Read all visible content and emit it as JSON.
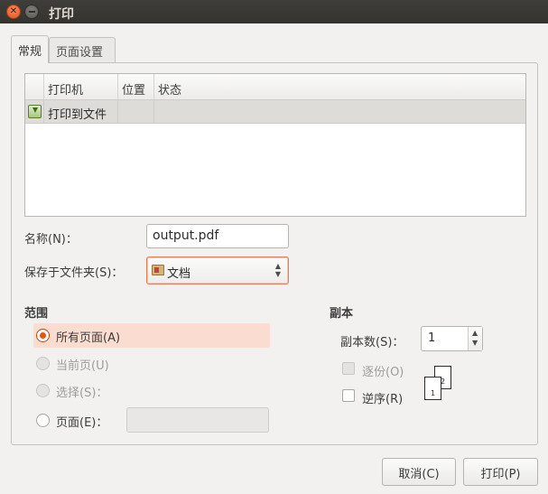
{
  "window": {
    "title": "打印"
  },
  "tabs": [
    {
      "label": "常规",
      "active": true
    },
    {
      "label": "页面设置",
      "active": false
    }
  ],
  "printer_list": {
    "columns": [
      "打印机",
      "位置",
      "状态"
    ],
    "rows": [
      {
        "icon": "print-to-file-icon",
        "name": "打印到文件",
        "location": "",
        "status": "",
        "selected": true
      }
    ]
  },
  "name_field": {
    "label": "名称(N)：",
    "value": "output.pdf"
  },
  "folder_field": {
    "label": "保存于文件夹(S)：",
    "value": "文档",
    "icon": "folder-icon"
  },
  "range": {
    "title": "范围",
    "options": [
      {
        "label": "所有页面(A)",
        "checked": true,
        "enabled": true
      },
      {
        "label": "当前页(U)",
        "checked": false,
        "enabled": false
      },
      {
        "label": "选择(S)：",
        "checked": false,
        "enabled": false
      },
      {
        "label": "页面(E)：",
        "checked": false,
        "enabled": true
      }
    ],
    "pages_value": ""
  },
  "copies": {
    "title": "副本",
    "count_label": "副本数(S)：",
    "count_value": "1",
    "collate_label": "逐份(O)",
    "reverse_label": "逆序(R)",
    "collate_icon_pages": [
      "1",
      "2"
    ]
  },
  "buttons": {
    "cancel": "取消(C)",
    "print": "打印(P)"
  },
  "colors": {
    "accent": "#e1551d",
    "selection_bg": "#fadcd0",
    "titlebar": "#3c3b37"
  }
}
